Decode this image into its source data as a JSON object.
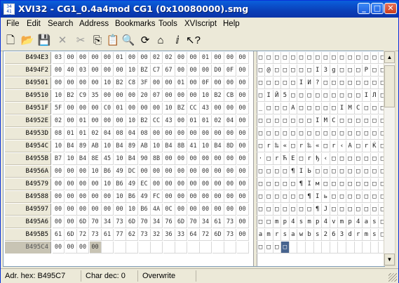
{
  "window": {
    "title": "XVI32 - CG1_0.4a4mod CG1 (0x10080000).smg",
    "icon_text": "34\n41\nAD",
    "minimize": "_",
    "maximize": "□",
    "close": "✕"
  },
  "menu": [
    "File",
    "Edit",
    "Search",
    "Address",
    "Bookmarks",
    "Tools",
    "XVIscript",
    "Help"
  ],
  "toolbar": [
    {
      "name": "new-icon",
      "glyph": "🗋",
      "enabled": true
    },
    {
      "name": "open-icon",
      "glyph": "📂",
      "enabled": true
    },
    {
      "name": "save-icon",
      "glyph": "💾",
      "enabled": true
    },
    {
      "name": "delete-icon",
      "glyph": "✕",
      "enabled": false
    },
    {
      "name": "cut-icon",
      "glyph": "✂",
      "enabled": false
    },
    {
      "name": "copy-icon",
      "glyph": "⎘",
      "enabled": true
    },
    {
      "name": "paste-icon",
      "glyph": "📋",
      "enabled": true
    },
    {
      "name": "find-icon",
      "glyph": "🔍",
      "enabled": true
    },
    {
      "name": "replace-icon",
      "glyph": "⟳",
      "enabled": true
    },
    {
      "name": "goto-icon",
      "glyph": "⌂",
      "enabled": true
    },
    {
      "name": "script-icon",
      "glyph": "ⅈ",
      "enabled": true
    },
    {
      "name": "help-pointer-icon",
      "glyph": "↖?",
      "enabled": true
    }
  ],
  "rows": [
    {
      "addr": "B494E3",
      "hex": [
        "03",
        "00",
        "00",
        "00",
        "00",
        "01",
        "00",
        "00",
        "02",
        "02",
        "00",
        "00",
        "01",
        "00",
        "00",
        "00"
      ],
      "ascii": [
        "□",
        "□",
        "□",
        "□",
        "□",
        "□",
        "□",
        "□",
        "□",
        "□",
        "□",
        "□",
        "□",
        "□",
        "□",
        "□"
      ]
    },
    {
      "addr": "B494F2",
      "hex": [
        "00",
        "40",
        "03",
        "00",
        "00",
        "00",
        "10",
        "BZ",
        "C7",
        "67",
        "00",
        "00",
        "00",
        "D0",
        "0F",
        "00"
      ],
      "ascii": [
        "□",
        "@",
        "□",
        "□",
        "□",
        "□",
        "□",
        "I",
        "3",
        "g",
        "□",
        "□",
        "□",
        "P",
        "□",
        "□"
      ]
    },
    {
      "addr": "B49501",
      "hex": [
        "00",
        "00",
        "00",
        "00",
        "10",
        "B2",
        "C8",
        "3F",
        "00",
        "00",
        "01",
        "00",
        "0F",
        "00",
        "00",
        "00"
      ],
      "ascii": [
        "□",
        "□",
        "□",
        "□",
        "□",
        "I",
        "И",
        "?",
        "□",
        "□",
        "□",
        "□",
        "□",
        "□",
        "□",
        "□"
      ]
    },
    {
      "addr": "B49510",
      "hex": [
        "10",
        "B2",
        "C9",
        "35",
        "00",
        "00",
        "00",
        "20",
        "07",
        "00",
        "00",
        "00",
        "10",
        "B2",
        "CB",
        "00"
      ],
      "ascii": [
        "□",
        "I",
        "Й",
        "5",
        "□",
        "□",
        "□",
        "□",
        "□",
        "□",
        "□",
        "□",
        "□",
        "I",
        "Л",
        "□"
      ]
    },
    {
      "addr": "B4951F",
      "hex": [
        "5F",
        "00",
        "00",
        "00",
        "C0",
        "01",
        "00",
        "00",
        "00",
        "10",
        "BZ",
        "CC",
        "43",
        "00",
        "00",
        "00"
      ],
      "ascii": [
        "_",
        "□",
        "□",
        "□",
        "A",
        "□",
        "□",
        "□",
        "□",
        "□",
        "I",
        "M",
        "C",
        "□",
        "□",
        "□"
      ]
    },
    {
      "addr": "B4952E",
      "hex": [
        "02",
        "00",
        "01",
        "00",
        "00",
        "00",
        "10",
        "B2",
        "CC",
        "43",
        "00",
        "01",
        "01",
        "02",
        "04",
        "00"
      ],
      "ascii": [
        "□",
        "□",
        "□",
        "□",
        "□",
        "□",
        "□",
        "I",
        "M",
        "C",
        "□",
        "□",
        "□",
        "□",
        "□",
        "□"
      ]
    },
    {
      "addr": "B4953D",
      "hex": [
        "08",
        "01",
        "01",
        "02",
        "04",
        "08",
        "04",
        "08",
        "00",
        "00",
        "00",
        "00",
        "00",
        "00",
        "00",
        "00"
      ],
      "ascii": [
        "□",
        "□",
        "□",
        "□",
        "□",
        "□",
        "□",
        "□",
        "□",
        "□",
        "□",
        "□",
        "□",
        "□",
        "□",
        "□"
      ]
    },
    {
      "addr": "B4954C",
      "hex": [
        "10",
        "B4",
        "89",
        "AB",
        "10",
        "B4",
        "89",
        "AB",
        "10",
        "B4",
        "8B",
        "41",
        "10",
        "B4",
        "8D",
        "00"
      ],
      "ascii": [
        "□",
        "r",
        "‰",
        "«",
        "□",
        "r",
        "‰",
        "«",
        "□",
        "r",
        "‹",
        "A",
        "□",
        "r",
        "Ќ",
        "□"
      ]
    },
    {
      "addr": "B4955B",
      "hex": [
        "B7",
        "10",
        "B4",
        "8E",
        "45",
        "10",
        "B4",
        "90",
        "8B",
        "00",
        "00",
        "00",
        "00",
        "00",
        "00",
        "00"
      ],
      "ascii": [
        "·",
        "□",
        "r",
        "Ћ",
        "E",
        "□",
        "r",
        "ђ",
        "‹",
        "□",
        "□",
        "□",
        "□",
        "□",
        "□",
        "□"
      ]
    },
    {
      "addr": "B4956A",
      "hex": [
        "00",
        "00",
        "00",
        "10",
        "B6",
        "49",
        "DC",
        "00",
        "00",
        "00",
        "00",
        "00",
        "00",
        "00",
        "00",
        "00"
      ],
      "ascii": [
        "□",
        "□",
        "□",
        "□",
        "¶",
        "I",
        "Ь",
        "□",
        "□",
        "□",
        "□",
        "□",
        "□",
        "□",
        "□",
        "□"
      ]
    },
    {
      "addr": "B49579",
      "hex": [
        "00",
        "00",
        "00",
        "00",
        "10",
        "B6",
        "49",
        "EC",
        "00",
        "00",
        "00",
        "00",
        "00",
        "00",
        "00",
        "00"
      ],
      "ascii": [
        "□",
        "□",
        "□",
        "□",
        "□",
        "¶",
        "I",
        "м",
        "□",
        "□",
        "□",
        "□",
        "□",
        "□",
        "□",
        "□"
      ]
    },
    {
      "addr": "B49588",
      "hex": [
        "00",
        "00",
        "00",
        "00",
        "00",
        "10",
        "B6",
        "49",
        "FC",
        "00",
        "00",
        "00",
        "00",
        "00",
        "00",
        "00"
      ],
      "ascii": [
        "□",
        "□",
        "□",
        "□",
        "□",
        "□",
        "¶",
        "I",
        "ь",
        "□",
        "□",
        "□",
        "□",
        "□",
        "□",
        "□"
      ]
    },
    {
      "addr": "B49597",
      "hex": [
        "00",
        "00",
        "00",
        "00",
        "00",
        "00",
        "10",
        "B6",
        "4A",
        "0C",
        "00",
        "00",
        "00",
        "00",
        "00",
        "00"
      ],
      "ascii": [
        "□",
        "□",
        "□",
        "□",
        "□",
        "□",
        "□",
        "¶",
        "J",
        "□",
        "□",
        "□",
        "□",
        "□",
        "□",
        "□"
      ]
    },
    {
      "addr": "B495A6",
      "hex": [
        "00",
        "00",
        "6D",
        "70",
        "34",
        "73",
        "6D",
        "70",
        "34",
        "76",
        "6D",
        "70",
        "34",
        "61",
        "73",
        "00"
      ],
      "ascii": [
        "□",
        "□",
        "m",
        "p",
        "4",
        "s",
        "m",
        "p",
        "4",
        "v",
        "m",
        "p",
        "4",
        "a",
        "s",
        "□"
      ]
    },
    {
      "addr": "B495B5",
      "hex": [
        "61",
        "6D",
        "72",
        "73",
        "61",
        "77",
        "62",
        "73",
        "32",
        "36",
        "33",
        "64",
        "72",
        "6D",
        "73",
        "00"
      ],
      "ascii": [
        "a",
        "m",
        "r",
        "s",
        "a",
        "w",
        "b",
        "s",
        "2",
        "6",
        "3",
        "d",
        "r",
        "m",
        "s",
        "□"
      ]
    },
    {
      "addr": "B495C4",
      "hex": [
        "00",
        "00",
        "00",
        "00",
        "",
        "",
        "",
        "",
        "",
        "",
        "",
        "",
        "",
        "",
        "",
        ""
      ],
      "ascii": [
        "□",
        "□",
        "□",
        "□",
        "",
        "",
        "",
        "",
        "",
        "",
        "",
        "",
        "",
        "",
        "",
        ""
      ],
      "current": true
    }
  ],
  "status": {
    "address": "Adr. hex: B495C7",
    "char": "Char dec: 0",
    "mode": "Overwrite"
  }
}
